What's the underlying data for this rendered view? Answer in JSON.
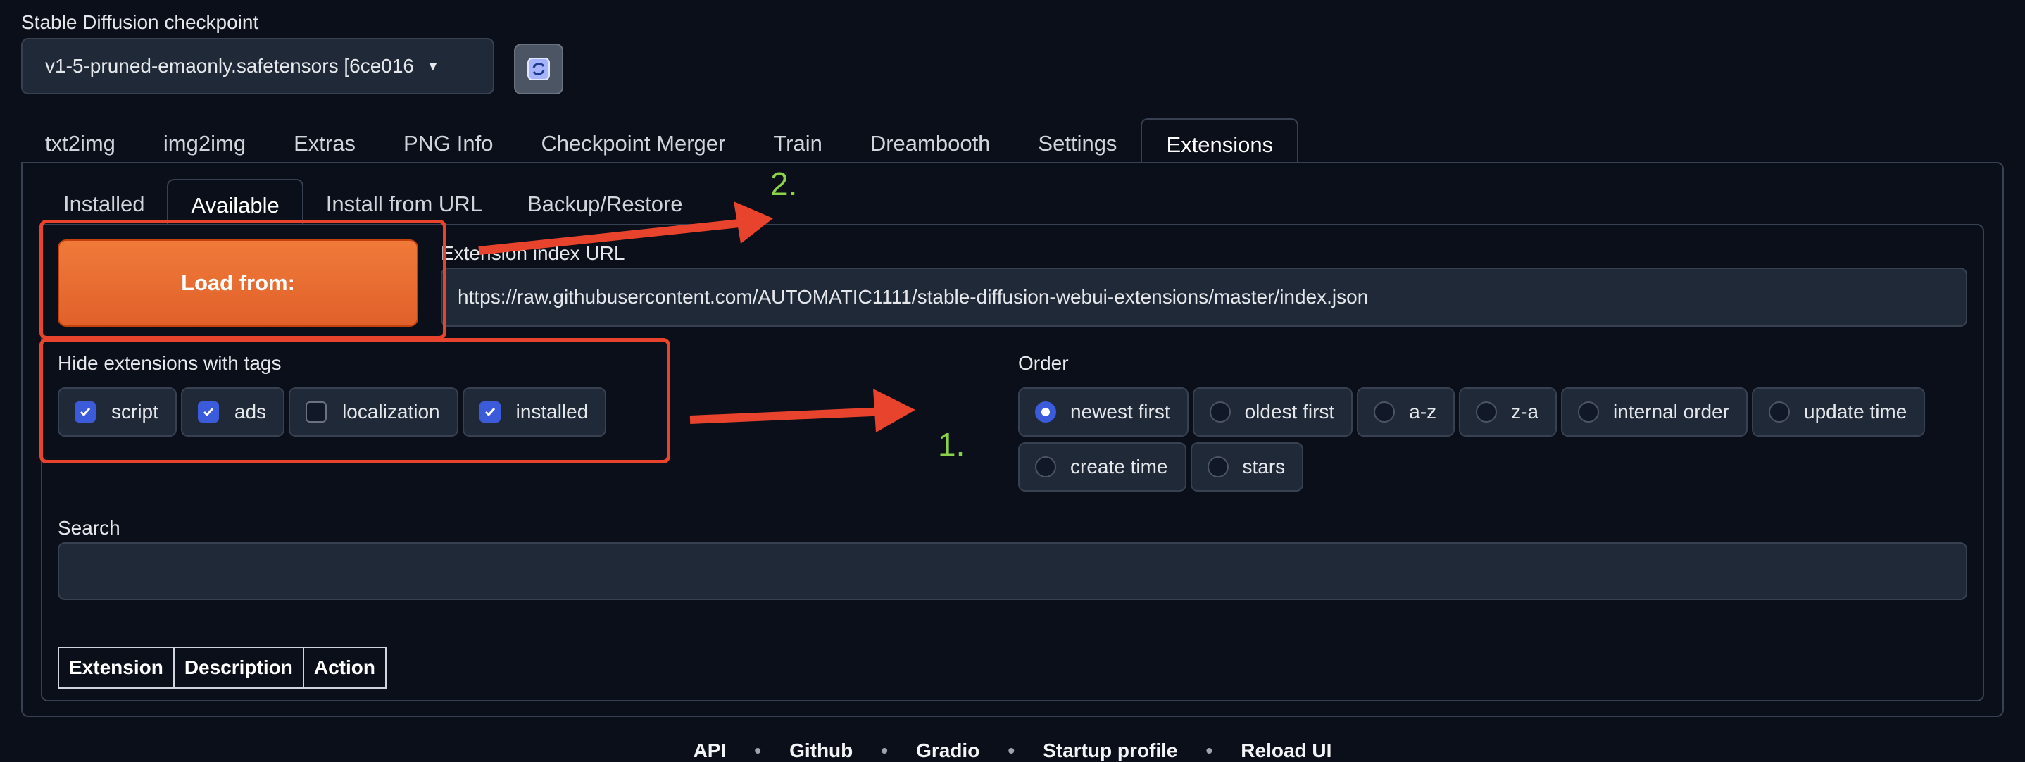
{
  "checkpoint": {
    "label": "Stable Diffusion checkpoint",
    "value": "v1-5-pruned-emaonly.safetensors [6ce016"
  },
  "tabs": [
    "txt2img",
    "img2img",
    "Extras",
    "PNG Info",
    "Checkpoint Merger",
    "Train",
    "Dreambooth",
    "Settings",
    "Extensions"
  ],
  "subtabs": [
    "Installed",
    "Available",
    "Install from URL",
    "Backup/Restore"
  ],
  "load_button": "Load from:",
  "url": {
    "label": "Extension index URL",
    "value": "https://raw.githubusercontent.com/AUTOMATIC1111/stable-diffusion-webui-extensions/master/index.json"
  },
  "hide_tags": {
    "label": "Hide extensions with tags",
    "items": [
      {
        "label": "script",
        "checked": true
      },
      {
        "label": "ads",
        "checked": true
      },
      {
        "label": "localization",
        "checked": false
      },
      {
        "label": "installed",
        "checked": true
      }
    ]
  },
  "order": {
    "label": "Order",
    "options": [
      "newest first",
      "oldest first",
      "a-z",
      "z-a",
      "internal order",
      "update time",
      "create time",
      "stars"
    ],
    "selected": "newest first"
  },
  "search": {
    "label": "Search",
    "value": ""
  },
  "table_headers": [
    "Extension",
    "Description",
    "Action"
  ],
  "footer": [
    "API",
    "Github",
    "Gradio",
    "Startup profile",
    "Reload UI"
  ],
  "annotations": {
    "first": "1.",
    "second": "2."
  },
  "colors": {
    "accent_orange": "#e8692f",
    "annotation_red": "#e8432d",
    "annotation_green": "#8bd14a",
    "background": "#0b0f19"
  }
}
